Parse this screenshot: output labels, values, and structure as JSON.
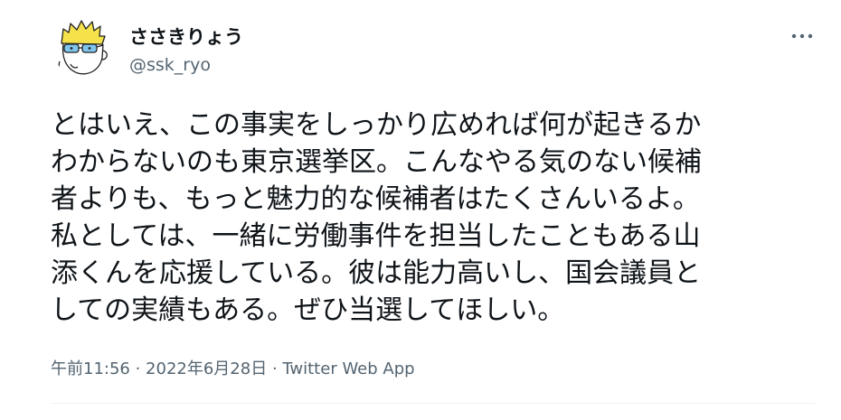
{
  "author": {
    "display_name": "ささきりょう",
    "handle": "@ssk_ryo"
  },
  "more_icon": "more-horizontal-icon",
  "tweet": {
    "lines": [
      "とはいえ、この事実をしっかり広めれば何が起きるか",
      "わからないのも東京選挙区。こんなやる気のない候補",
      "者よりも、もっと魅力的な候補者はたくさんいるよ。",
      "私としては、一緒に労働事件を担当したこともある山",
      "添くんを応援している。彼は能力高いし、国会議員と",
      "しての実績もある。ぜひ当選してほしい。"
    ]
  },
  "meta": {
    "time": "午前11:56",
    "separator_1": " · ",
    "date": "2022年6月28日",
    "separator_2": " · ",
    "source": "Twitter Web App"
  },
  "colors": {
    "text": "#0f1419",
    "secondary": "#536471",
    "divider": "#eff3f4"
  }
}
